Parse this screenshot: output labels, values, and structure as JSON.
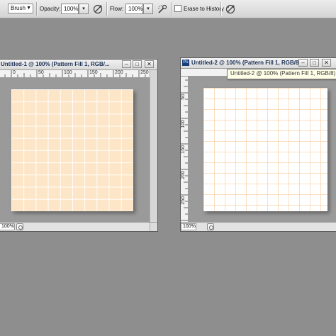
{
  "options_bar": {
    "mode_value": "Brush",
    "opacity_label": "Opacity:",
    "opacity_value": "100%",
    "flow_label": "Flow:",
    "flow_value": "100%",
    "erase_to_history_label": "Erase to History",
    "erase_to_history_checked": false,
    "icons": [
      "pressure-opacity-icon",
      "airbrush-icon",
      "pressure-size-icon"
    ]
  },
  "window1": {
    "title": "Untitled-1 @ 100% (Pattern Fill 1, RGB/...",
    "ruler_ticks": [
      "0",
      "50",
      "100",
      "150",
      "200",
      "250"
    ],
    "zoom": "100%",
    "pattern_color": "#fde6c8"
  },
  "window2": {
    "app_icon": "Ps",
    "title": "Untitled-2 @ 100% (Pattern Fill 1, RGB/8",
    "vruler_ticks": [
      "50",
      "100",
      "150",
      "200",
      "250"
    ],
    "zoom": "100%",
    "tooltip": "Untitled-2 @ 100% (Pattern Fill 1, RGB/8)",
    "pattern_color": "#ffffff"
  },
  "window_buttons": {
    "minimize": "–",
    "maximize": "□",
    "close": "✕"
  }
}
